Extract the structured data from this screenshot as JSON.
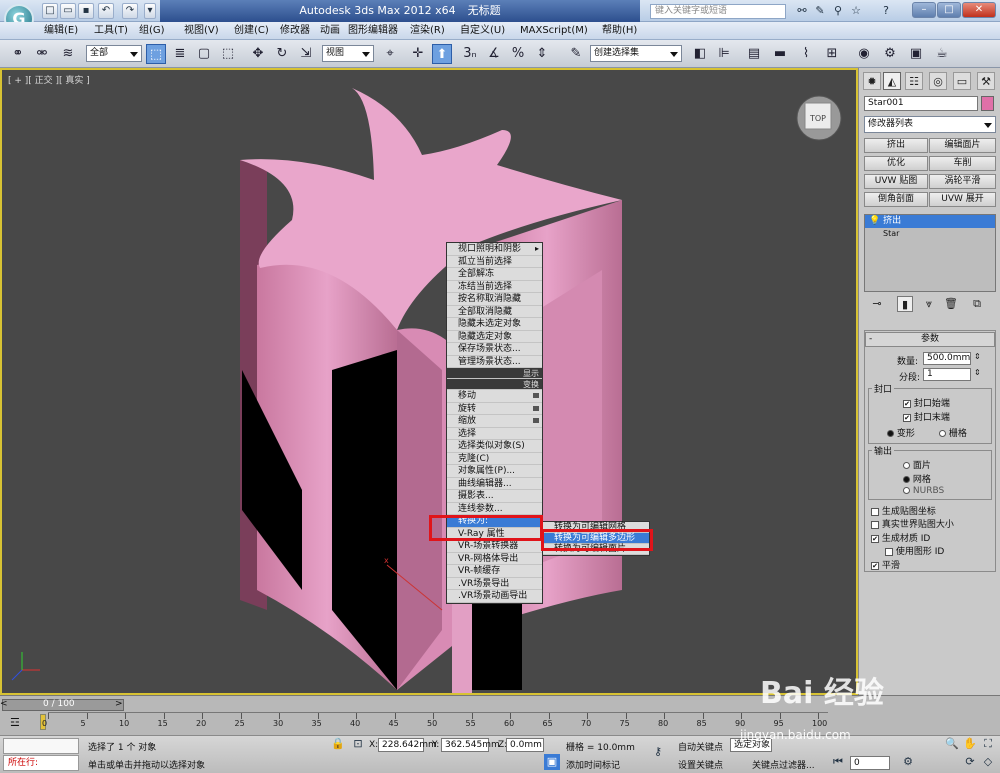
{
  "app": {
    "title": "Autodesk 3ds Max  2012 x64",
    "document": "无标题",
    "search_placeholder": "键入关键字或短语"
  },
  "menus": [
    "编辑(E)",
    "工具(T)",
    "组(G)",
    "视图(V)",
    "创建(C)",
    "修改器",
    "动画",
    "图形编辑器",
    "渲染(R)",
    "自定义(U)",
    "MAXScript(M)",
    "帮助(H)"
  ],
  "toolbar": {
    "selection_filter": "全部",
    "ref_coord": "视图",
    "named_selection": "创建选择集"
  },
  "viewport": {
    "label": "[ + ][ 正交 ][ 真实 ]",
    "object_color": "#e8a0c7"
  },
  "context_menu": {
    "items": [
      {
        "label": "视口照明和阴影",
        "kind": "arrow"
      },
      {
        "label": "孤立当前选择",
        "kind": ""
      },
      {
        "label": "全部解冻",
        "kind": ""
      },
      {
        "label": "冻结当前选择",
        "kind": ""
      },
      {
        "label": "按名称取消隐藏",
        "kind": ""
      },
      {
        "label": "全部取消隐藏",
        "kind": ""
      },
      {
        "label": "隐藏未选定对象",
        "kind": ""
      },
      {
        "label": "隐藏选定对象",
        "kind": ""
      },
      {
        "label": "保存场景状态...",
        "kind": ""
      },
      {
        "label": "管理场景状态...",
        "kind": ""
      },
      {
        "label": "显示",
        "kind": "dark"
      },
      {
        "label": "变换",
        "kind": "dark"
      },
      {
        "label": "移动",
        "kind": "box"
      },
      {
        "label": "旋转",
        "kind": "box"
      },
      {
        "label": "缩放",
        "kind": "box"
      },
      {
        "label": "选择",
        "kind": ""
      },
      {
        "label": "选择类似对象(S)",
        "kind": ""
      },
      {
        "label": "克隆(C)",
        "kind": ""
      },
      {
        "label": "对象属性(P)...",
        "kind": ""
      },
      {
        "label": "曲线编辑器...",
        "kind": ""
      },
      {
        "label": "摄影表...",
        "kind": ""
      },
      {
        "label": "连线参数...",
        "kind": ""
      },
      {
        "label": "转换为:",
        "kind": "hl"
      },
      {
        "label": "V-Ray 属性",
        "kind": ""
      },
      {
        "label": "VR-场景转换器",
        "kind": ""
      },
      {
        "label": "VR-网格体导出",
        "kind": ""
      },
      {
        "label": "VR-帧缓存",
        "kind": ""
      },
      {
        "label": ".VR场景导出",
        "kind": ""
      },
      {
        "label": ".VR场景动画导出",
        "kind": ""
      }
    ],
    "submenu": [
      "转换为可编辑网格",
      "转换为可编辑多边形",
      "转换为可编辑面片"
    ]
  },
  "command_panel": {
    "object_name": "Star001",
    "object_color": "#e070a8",
    "modifier_list": "修改器列表",
    "mod_buttons": [
      "挤出",
      "编辑面片",
      "优化",
      "车削",
      "UVW 贴图",
      "涡轮平滑",
      "倒角剖面",
      "UVW 展开"
    ],
    "stack": [
      "挤出",
      "Star"
    ],
    "rollout_title": "参数",
    "amount_label": "数量:",
    "amount_value": "500.0mm",
    "segments_label": "分段:",
    "segments_value": "1",
    "capping_title": "封口",
    "cap_start": "封口始端",
    "cap_end": "封口末端",
    "morph": "变形",
    "grid": "栅格",
    "output_title": "输出",
    "out_patch": "面片",
    "out_mesh": "网格",
    "out_nurbs": "NURBS",
    "gen_map": "生成贴图坐标",
    "real_world": "真实世界贴图大小",
    "gen_matid": "生成材质 ID",
    "use_shape_id": "使用图形 ID",
    "smooth": "平滑"
  },
  "timeline": {
    "frame": "0 / 100",
    "ticks": [
      "0",
      "5",
      "10",
      "15",
      "20",
      "25",
      "30",
      "35",
      "40",
      "45",
      "50",
      "55",
      "60",
      "65",
      "70",
      "75",
      "80",
      "85",
      "90",
      "95",
      "100"
    ]
  },
  "status": {
    "mode": "所在行:",
    "selection": "选择了 1 个 对象",
    "prompt": "单击或单击并拖动以选择对象",
    "x_label": "X:",
    "x_value": "228.642mm",
    "y_label": "Y:",
    "y_value": "362.545mm",
    "z_label": "Z:",
    "z_value": "0.0mm",
    "grid": "栅格 = 10.0mm",
    "add_time_tag": "添加时间标记",
    "auto_key": "自动关键点",
    "set_key": "设置关键点",
    "selected": "选定对象",
    "key_filter": "关键点过滤器...",
    "frame_field": "0"
  },
  "watermark": {
    "brand": "Bai 经验",
    "url": "jingyan.baidu.com"
  }
}
